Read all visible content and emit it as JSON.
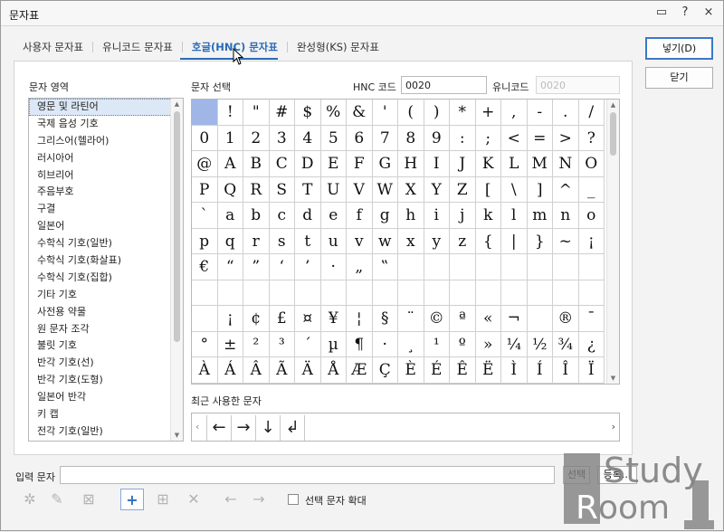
{
  "title": "문자표",
  "title_icons": [
    "chat-icon",
    "help-icon",
    "close-icon"
  ],
  "title_icon_glyphs": [
    "▭",
    "?",
    "×"
  ],
  "tabs": [
    {
      "label": "사용자 문자표",
      "active": false
    },
    {
      "label": "유니코드 문자표",
      "active": false
    },
    {
      "label": "호글(HNC) 문자표",
      "active": true
    },
    {
      "label": "완성형(KS) 문자표",
      "active": false
    }
  ],
  "buttons": {
    "insert": "넣기(D)",
    "close": "닫기",
    "select": "선택",
    "register": "등록..."
  },
  "category_label": "문자 영역",
  "char_select_label": "문자 선택",
  "hnc_code_label": "HNC 코드",
  "hnc_code_value": "0020",
  "unicode_label": "유니코드",
  "unicode_value": "0020",
  "categories": [
    "영문 및 라틴어",
    "국제 음성 기호",
    "그리스어(헬라어)",
    "러시아어",
    "히브리어",
    "주음부호",
    "구결",
    "일본어",
    "수학식 기호(일반)",
    "수학식 기호(화살표)",
    "수학식 기호(집합)",
    "기타 기호",
    "사전용 약물",
    "원 문자 조각",
    "불릿 기호",
    "반각 기호(선)",
    "반각 기호(도형)",
    "일본어 반각",
    "키 캡",
    "전각 기호(일반)"
  ],
  "selected_category": 0,
  "grid_rows": [
    [
      " ",
      "!",
      "\"",
      "#",
      "$",
      "%",
      "&",
      "'",
      "(",
      ")",
      "*",
      "+",
      ",",
      "-",
      ".",
      "/"
    ],
    [
      "0",
      "1",
      "2",
      "3",
      "4",
      "5",
      "6",
      "7",
      "8",
      "9",
      ":",
      ";",
      "<",
      "=",
      ">",
      "?"
    ],
    [
      "@",
      "A",
      "B",
      "C",
      "D",
      "E",
      "F",
      "G",
      "H",
      "I",
      "J",
      "K",
      "L",
      "M",
      "N",
      "O"
    ],
    [
      "P",
      "Q",
      "R",
      "S",
      "T",
      "U",
      "V",
      "W",
      "X",
      "Y",
      "Z",
      "[",
      "\\",
      "]",
      "^",
      "_"
    ],
    [
      "`",
      "a",
      "b",
      "c",
      "d",
      "e",
      "f",
      "g",
      "h",
      "i",
      "j",
      "k",
      "l",
      "m",
      "n",
      "o"
    ],
    [
      "p",
      "q",
      "r",
      "s",
      "t",
      "u",
      "v",
      "w",
      "x",
      "y",
      "z",
      "{",
      "|",
      "}",
      "~",
      "¡"
    ],
    [
      "€",
      "“",
      "”",
      "‘",
      "’",
      "·",
      "„",
      "‟",
      "",
      "",
      "",
      "",
      "",
      "",
      "",
      ""
    ],
    [
      "",
      "",
      "",
      "",
      "",
      "",
      "",
      "",
      "",
      "",
      "",
      "",
      "",
      "",
      "",
      ""
    ],
    [
      "",
      "¡",
      "¢",
      "£",
      "¤",
      "¥",
      "¦",
      "§",
      "¨",
      "©",
      "ª",
      "«",
      "¬",
      "",
      "®",
      "¯"
    ],
    [
      "°",
      "±",
      "²",
      "³",
      "´",
      "µ",
      "¶",
      "·",
      "¸",
      "¹",
      "º",
      "»",
      "¼",
      "½",
      "¾",
      "¿"
    ],
    [
      "À",
      "Á",
      "Â",
      "Ã",
      "Ä",
      "Å",
      "Æ",
      "Ç",
      "È",
      "É",
      "Ê",
      "Ë",
      "Ì",
      "Í",
      "Î",
      "Ï"
    ]
  ],
  "selected_cell": [
    0,
    0
  ],
  "recent_label": "최근 사용한 문자",
  "recent_chars": [
    "←",
    "→",
    "↓",
    "↲"
  ],
  "recent_prev_glyph": "‹",
  "recent_next_glyph": "›",
  "input_label": "입력 문자",
  "input_value": "",
  "tool_icons": [
    {
      "name": "add-user-char-icon",
      "glyph": "✲",
      "enabled": false
    },
    {
      "name": "edit-user-char-icon",
      "glyph": "✎",
      "enabled": false
    },
    {
      "name": "delete-user-char-icon",
      "glyph": "⊠",
      "enabled": false
    },
    {
      "name": "add-icon",
      "glyph": "+",
      "enabled": true
    },
    {
      "name": "add-table-icon",
      "glyph": "⊞",
      "enabled": false
    },
    {
      "name": "remove-icon",
      "glyph": "✕",
      "enabled": false
    },
    {
      "name": "arrow-left-icon",
      "glyph": "←",
      "enabled": false
    },
    {
      "name": "arrow-right-icon",
      "glyph": "→",
      "enabled": false
    }
  ],
  "enlarge_label": "선택 문자 확대",
  "enlarge_checked": false,
  "watermark": "StudyRoom",
  "colors": {
    "accent": "#2a6bb8",
    "selected_cell": "#9fb6e6",
    "selected_item": "#dde8f6"
  }
}
